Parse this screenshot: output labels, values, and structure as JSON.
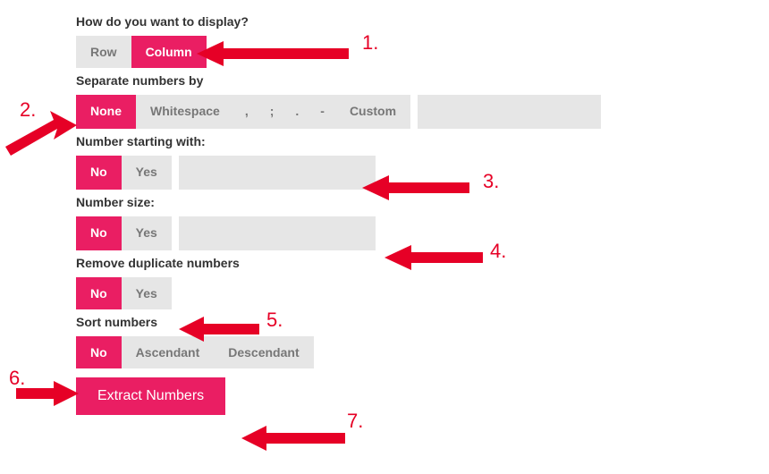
{
  "display": {
    "label": "How do you want to display?",
    "row": "Row",
    "column": "Column"
  },
  "separator": {
    "label": "Separate numbers by",
    "none": "None",
    "whitespace": "Whitespace",
    "comma": ",",
    "semicolon": ";",
    "dot": ".",
    "dash": "-",
    "custom": "Custom",
    "custom_value": ""
  },
  "start": {
    "label": "Number starting with:",
    "no": "No",
    "yes": "Yes",
    "value": ""
  },
  "size": {
    "label": "Number size:",
    "no": "No",
    "yes": "Yes",
    "value": ""
  },
  "dup": {
    "label": "Remove duplicate numbers",
    "no": "No",
    "yes": "Yes"
  },
  "sort": {
    "label": "Sort numbers",
    "no": "No",
    "asc": "Ascendant",
    "desc": "Descendant"
  },
  "submit": "Extract Numbers",
  "annotations": {
    "n1": "1.",
    "n2": "2.",
    "n3": "3.",
    "n4": "4.",
    "n5": "5.",
    "n6": "6.",
    "n7": "7."
  }
}
